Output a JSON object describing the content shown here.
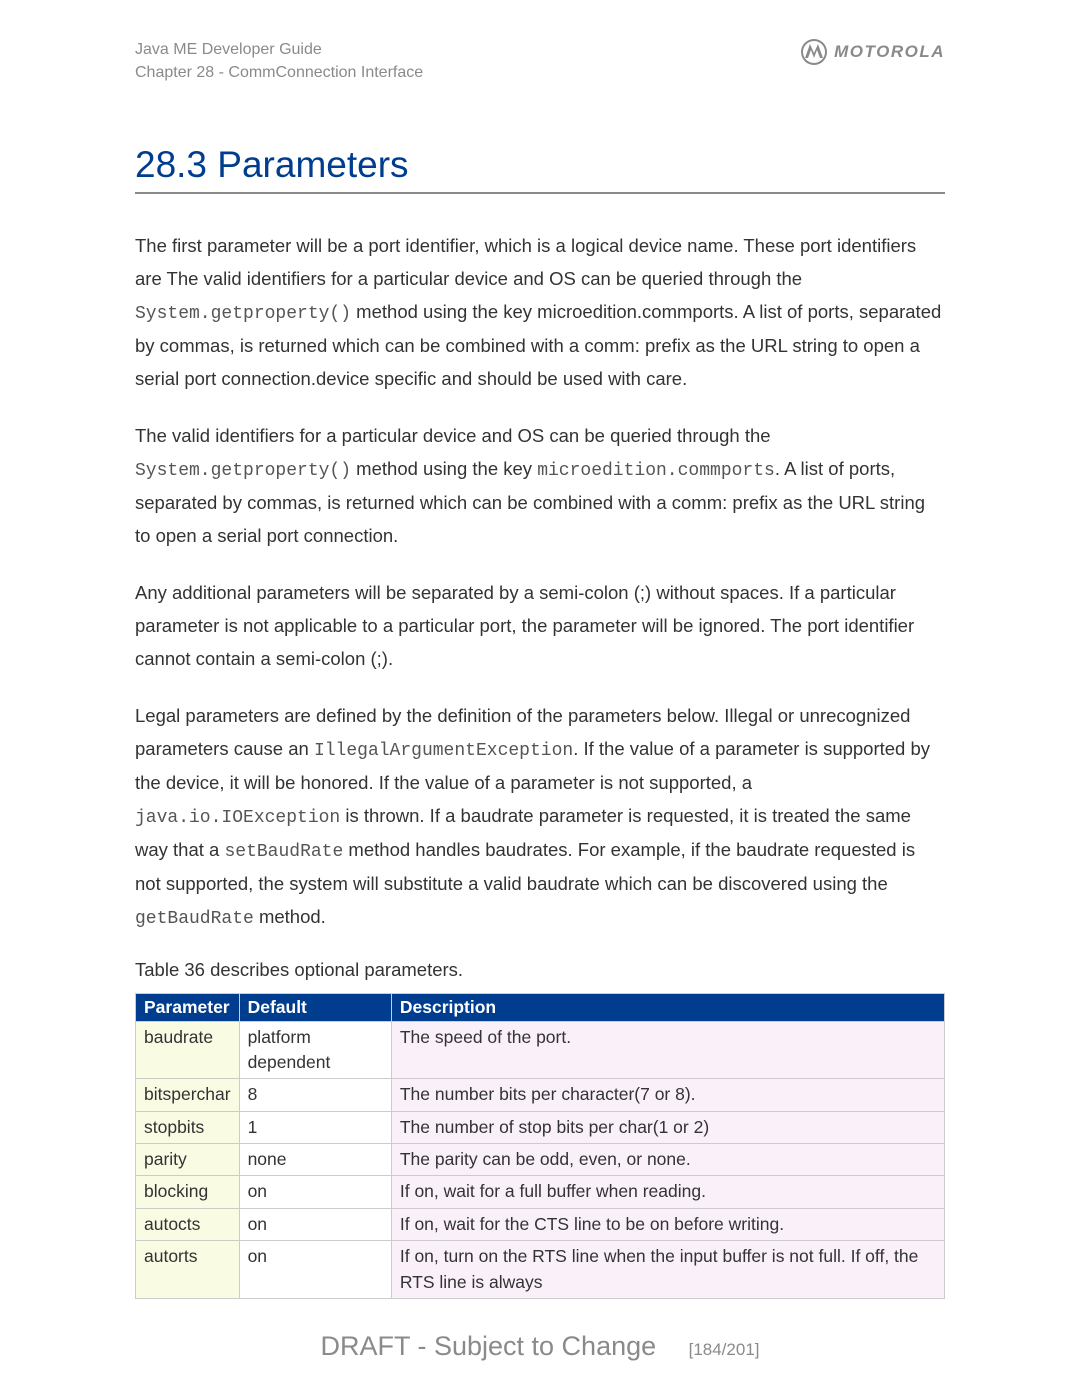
{
  "header": {
    "line1": "Java ME Developer Guide",
    "line2": "Chapter 28 - CommConnection Interface",
    "brand": "MOTOROLA"
  },
  "section": {
    "number": "28.3",
    "title": "Parameters"
  },
  "paragraphs": {
    "p1_a": "The first parameter will be a port identifier, which is a logical device name. These port identifiers are The valid identifiers for a particular device and OS can be queried through the ",
    "p1_code1": "System.getproperty()",
    "p1_b": " method using the key microedition.commports. A list of ports, separated by commas, is returned which can be combined with a comm: prefix as the URL string to open a serial port connection.device specific and should be used with care.",
    "p2_a": "The valid identifiers for a particular device and OS can be queried through the ",
    "p2_code1": "System.getproperty()",
    "p2_b": " method using the key ",
    "p2_code2": "microedition.commports",
    "p2_c": ". A list of ports, separated by commas, is returned which can be combined with a comm: prefix as the URL string to open a serial port connection.",
    "p3": "Any additional parameters will be separated by a semi-colon (;) without spaces. If a particular parameter is not applicable to a particular port, the parameter will be ignored. The port identifier cannot contain a semi-colon (;).",
    "p4_a": "Legal parameters are defined by the definition of the parameters below. Illegal or unrecognized parameters cause an ",
    "p4_code1": "IllegalArgumentException",
    "p4_b": ". If the value of a parameter is supported by the device, it will be honored. If the value of a parameter is not supported, a ",
    "p4_code2": "java.io.IOException",
    "p4_c": " is thrown. If a baudrate parameter is requested, it is treated the same way that a ",
    "p4_code3": "setBaudRate",
    "p4_d": " method handles baudrates. For example, if the baudrate requested is not supported, the system will substitute a valid baudrate which can be discovered using the ",
    "p4_code4": "getBaudRate",
    "p4_e": " method.",
    "table_caption": "Table 36 describes optional parameters."
  },
  "table": {
    "headers": {
      "c1": "Parameter",
      "c2": "Default",
      "c3": "Description"
    },
    "rows": [
      {
        "param": "baudrate",
        "default": "platform dependent",
        "desc": "The speed of the port."
      },
      {
        "param": "bitsperchar",
        "default": "8",
        "desc": "The number bits per character(7 or 8)."
      },
      {
        "param": "stopbits",
        "default": "1",
        "desc": "The number of stop bits per char(1 or 2)"
      },
      {
        "param": "parity",
        "default": "none",
        "desc": "The parity can be odd, even, or none."
      },
      {
        "param": "blocking",
        "default": "on",
        "desc": "If on, wait for a full buffer when reading."
      },
      {
        "param": "autocts",
        "default": "on",
        "desc": "If on, wait for the CTS line to be on before writing."
      },
      {
        "param": "autorts",
        "default": "on",
        "desc": "If on, turn on the RTS line when the input buffer is not full. If off, the RTS line is always"
      }
    ]
  },
  "footer": {
    "draft": "DRAFT - Subject to Change",
    "page": "[184/201]"
  }
}
